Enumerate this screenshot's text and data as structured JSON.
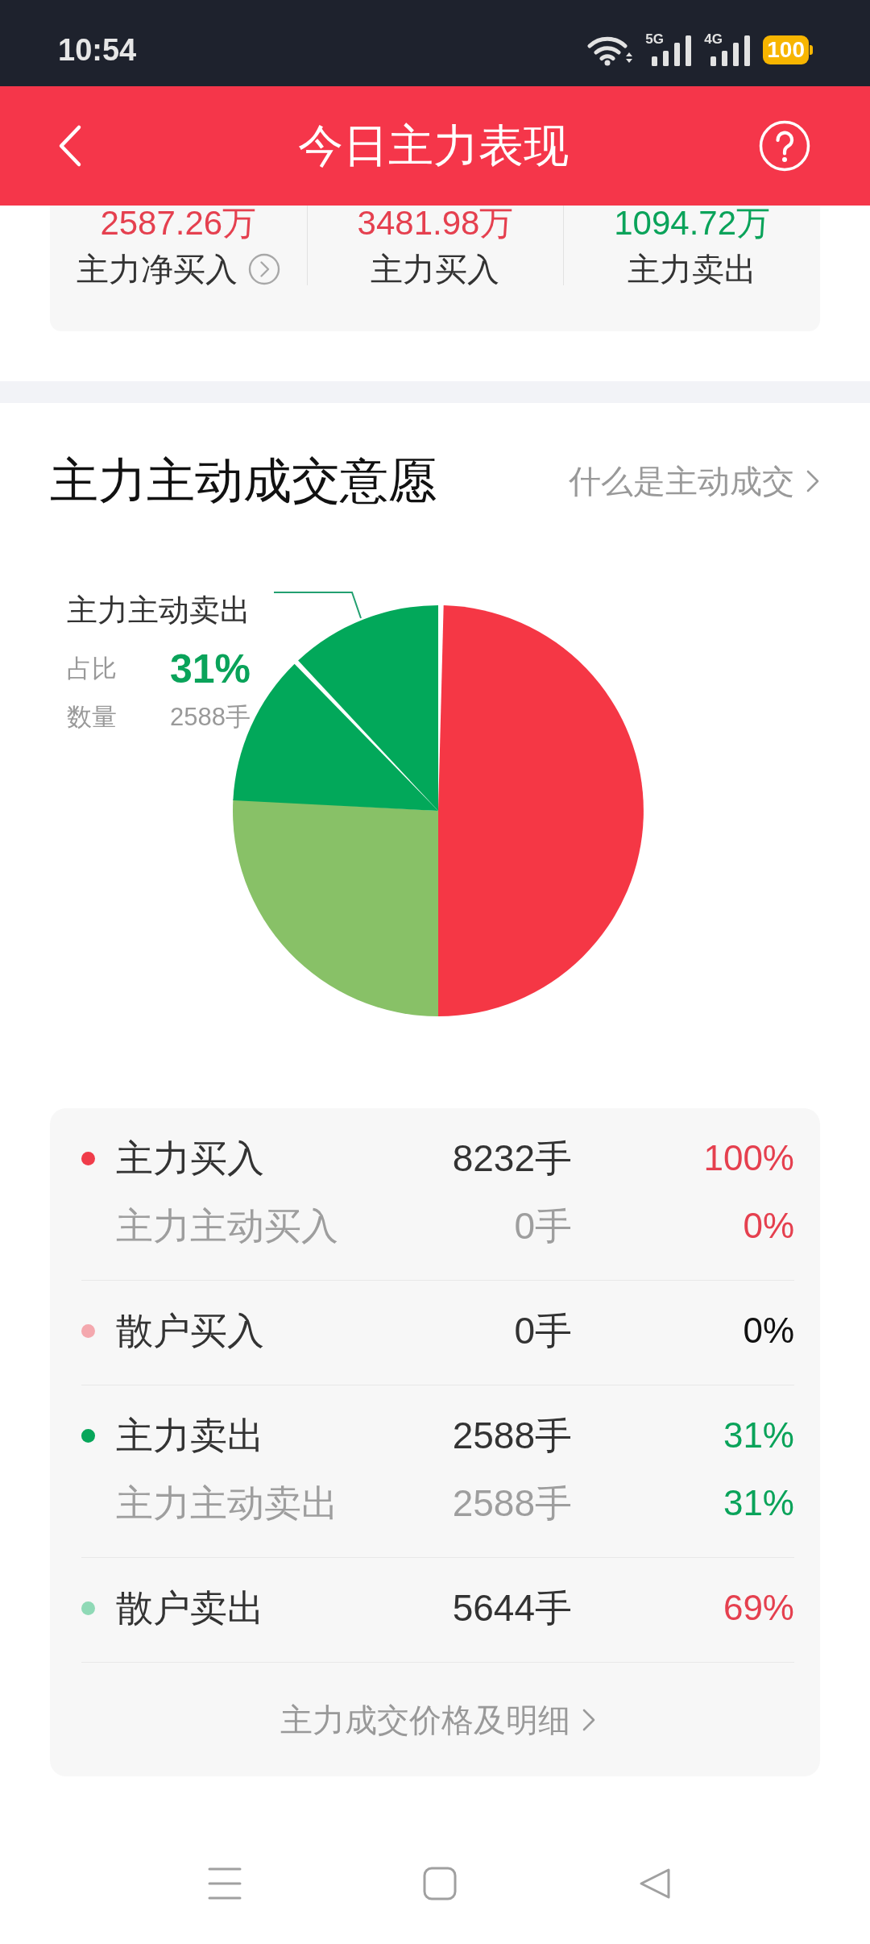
{
  "status_bar": {
    "time": "10:54",
    "signals": [
      {
        "label": "5G"
      },
      {
        "label": "4G"
      }
    ],
    "battery": "100"
  },
  "header": {
    "title": "今日主力表现"
  },
  "summary": [
    {
      "value": "2587.26万",
      "label": "主力净买入",
      "color": "#e5404f",
      "detail_link": true
    },
    {
      "value": "3481.98万",
      "label": "主力买入",
      "color": "#e5404f",
      "detail_link": false
    },
    {
      "value": "1094.72万",
      "label": "主力卖出",
      "color": "#0aa35a",
      "detail_link": false
    }
  ],
  "section": {
    "title": "主力主动成交意愿",
    "link": "什么是主动成交"
  },
  "pie": {
    "callout": {
      "title": "主力主动卖出",
      "share_label": "占比",
      "share": "31%",
      "amount_label": "数量",
      "amount": "2588手",
      "color": "#0aa35a"
    }
  },
  "breakdown": {
    "groups": [
      {
        "rows": [
          {
            "kind": "main",
            "label": "主力买入",
            "count": "8232手",
            "percent": {
              "text": "100%",
              "color": "#e5404f"
            },
            "color": "#f03c4a"
          },
          {
            "kind": "sub",
            "label": "主力主动买入",
            "count": "0手",
            "percent": {
              "text": "0%",
              "color": "#e5404f"
            }
          }
        ]
      },
      {
        "rows": [
          {
            "kind": "main",
            "label": "散户买入",
            "count": "0手",
            "percent": {
              "text": "0%",
              "color": "#111111"
            },
            "color": "#f4a8ae"
          }
        ]
      },
      {
        "rows": [
          {
            "kind": "main",
            "label": "主力卖出",
            "count": "2588手",
            "percent": {
              "text": "31%",
              "color": "#0aa35a"
            },
            "color": "#07a65a"
          },
          {
            "kind": "sub",
            "label": "主力主动卖出",
            "count": "2588手",
            "percent": {
              "text": "31%",
              "color": "#0aa35a"
            }
          }
        ]
      },
      {
        "rows": [
          {
            "kind": "main",
            "label": "散户卖出",
            "count": "5644手",
            "percent": {
              "text": "69%",
              "color": "#e5404f"
            },
            "color": "#8fd9b6"
          }
        ]
      }
    ],
    "footer_link": "主力成交价格及明细"
  }
}
